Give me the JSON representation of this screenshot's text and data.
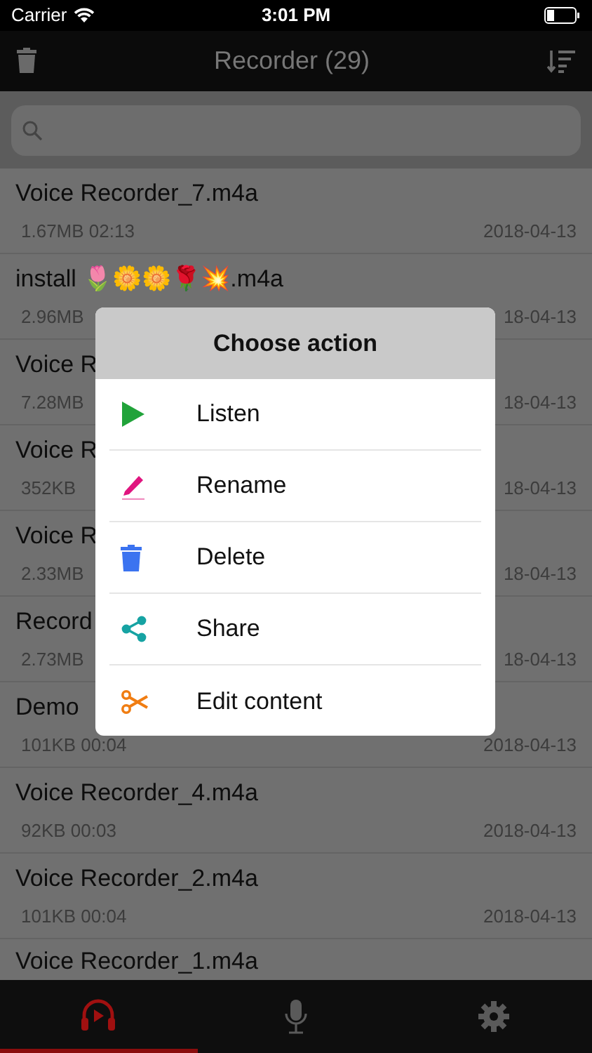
{
  "status_bar": {
    "carrier": "Carrier",
    "time": "3:01 PM"
  },
  "nav": {
    "title": "Recorder (29)"
  },
  "recordings": [
    {
      "title": "Voice Recorder_7.m4a",
      "meta": "1.67MB 02:13",
      "date": "2018-04-13"
    },
    {
      "title": "install 🌷🌼🌼🌹💥.m4a",
      "meta": "2.96MB",
      "date": "18-04-13"
    },
    {
      "title": "Voice R",
      "meta": "7.28MB",
      "date": "18-04-13"
    },
    {
      "title": "Voice R",
      "meta": "352KB",
      "date": "18-04-13"
    },
    {
      "title": "Voice R",
      "meta": "2.33MB",
      "date": "18-04-13"
    },
    {
      "title": "Record",
      "meta": "2.73MB",
      "date": "18-04-13"
    },
    {
      "title": "Demo",
      "meta": "101KB 00:04",
      "date": "2018-04-13"
    },
    {
      "title": "Voice Recorder_4.m4a",
      "meta": "92KB 00:03",
      "date": "2018-04-13"
    },
    {
      "title": "Voice Recorder_2.m4a",
      "meta": "101KB 00:04",
      "date": "2018-04-13"
    },
    {
      "title": "Voice Recorder_1.m4a"
    }
  ],
  "dialog": {
    "title": "Choose action",
    "actions": [
      {
        "kind": "listen",
        "label": "Listen"
      },
      {
        "kind": "rename",
        "label": "Rename"
      },
      {
        "kind": "delete",
        "label": "Delete"
      },
      {
        "kind": "share",
        "label": "Share"
      },
      {
        "kind": "edit",
        "label": "Edit content"
      }
    ]
  },
  "tabs": [
    {
      "kind": "player",
      "selected": true
    },
    {
      "kind": "mic",
      "selected": false
    },
    {
      "kind": "settings",
      "selected": false
    }
  ]
}
